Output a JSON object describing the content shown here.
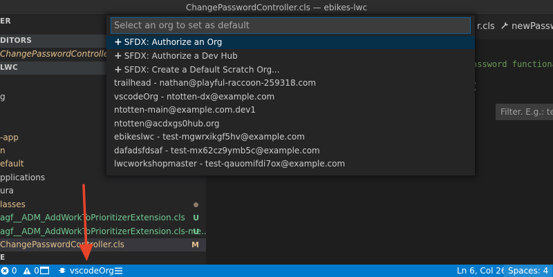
{
  "window": {
    "title": "ChangePasswordController.cls — ebikes-lwc"
  },
  "sidebar": {
    "explorer_title": "ER",
    "open_editors_header": "DITORS",
    "open_editor_file": "ChangePasswordController.cls",
    "project_header": "LWC",
    "items": [
      {
        "label": "g",
        "color": "#cccccc"
      },
      {
        "label": "-app",
        "color": "#e2c08d"
      },
      {
        "label": "n",
        "color": "#e2c08d"
      },
      {
        "label": "efault",
        "color": "#e2c08d"
      },
      {
        "label": "pplications",
        "color": "#cccccc"
      },
      {
        "label": "ura",
        "color": "#cccccc"
      },
      {
        "label": "lasses",
        "color": "#e2c08d"
      },
      {
        "label": "agf__ADM_AddWorkToPrioritizerExtension.cls",
        "color": "#73c991",
        "badge": "U"
      },
      {
        "label": "agf__ADM_AddWorkToPrioritizerExtension.cls-me...",
        "color": "#73c991",
        "badge": "U"
      },
      {
        "label": "ChangePasswordController.cls",
        "color": "#e2c08d",
        "badge": "M"
      },
      {
        "label": "E",
        "color": "#cccccc"
      }
    ]
  },
  "editor": {
    "tab_label": "r.cls",
    "breadcrumb_method": "newPasswo",
    "code_line_1": "assword functiona",
    "code_line_2": "",
    "filter_placeholder": "Filter. E.g.: text, **/"
  },
  "quickpick": {
    "placeholder": "Select an org to set as default",
    "items": [
      {
        "label": "SFDX: Authorize an Org",
        "plus": true
      },
      {
        "label": "SFDX: Authorize a Dev Hub",
        "plus": true
      },
      {
        "label": "SFDX: Create a Default Scratch Org...",
        "plus": true
      },
      {
        "label": "trailhead - nathan@playful-raccoon-259318.com",
        "plus": false
      },
      {
        "label": "vscodeOrg - ntotten-dx@example.com",
        "plus": false
      },
      {
        "label": "ntotten-main@example.com.dev1",
        "plus": false
      },
      {
        "label": "ntotten@acdxgs0hub.org",
        "plus": false
      },
      {
        "label": "ebikeslwc - test-mgwrxikgf5hv@example.com",
        "plus": false
      },
      {
        "label": "dafadsfdsaf - test-mx62cz9ymb5c@example.com",
        "plus": false
      },
      {
        "label": "lwcworkshopmaster - test-qauomifdi7ox@example.com",
        "plus": false
      }
    ]
  },
  "statusbar": {
    "errors": "0",
    "warnings": "0",
    "org": "vscodeOrg",
    "position": "Ln 6, Col 26",
    "spaces": "Spaces: 4"
  },
  "colors": {
    "accent": "#007acc",
    "annotation_arrow": "#e8442a"
  }
}
